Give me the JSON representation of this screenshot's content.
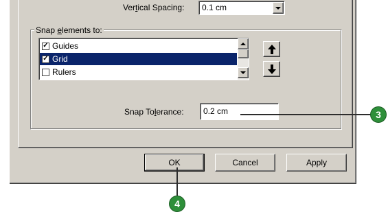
{
  "vertical_spacing": {
    "label_pre": "Ver",
    "label_ul": "t",
    "label_post": "ical Spacing:",
    "value": "0.1 cm"
  },
  "snap_group": {
    "legend_pre": "Snap ",
    "legend_ul": "e",
    "legend_post": "lements to:",
    "items": [
      {
        "label": "Guides",
        "checked": true,
        "selected": false
      },
      {
        "label": "Grid",
        "checked": true,
        "selected": true
      },
      {
        "label": "Rulers",
        "checked": false,
        "selected": false
      }
    ],
    "move_up_icon": "arrow-up-icon",
    "move_down_icon": "arrow-down-icon"
  },
  "snap_tolerance": {
    "label_pre": "Snap To",
    "label_ul": "l",
    "label_post": "erance:",
    "value": "0.2 cm"
  },
  "buttons": {
    "ok": "OK",
    "cancel": "Cancel",
    "apply": "Apply"
  },
  "callouts": {
    "three": "3",
    "four": "4"
  },
  "colors": {
    "dialog_bg": "#d4d0c8",
    "selection": "#0a246a",
    "callout": "#2e8f3a"
  }
}
